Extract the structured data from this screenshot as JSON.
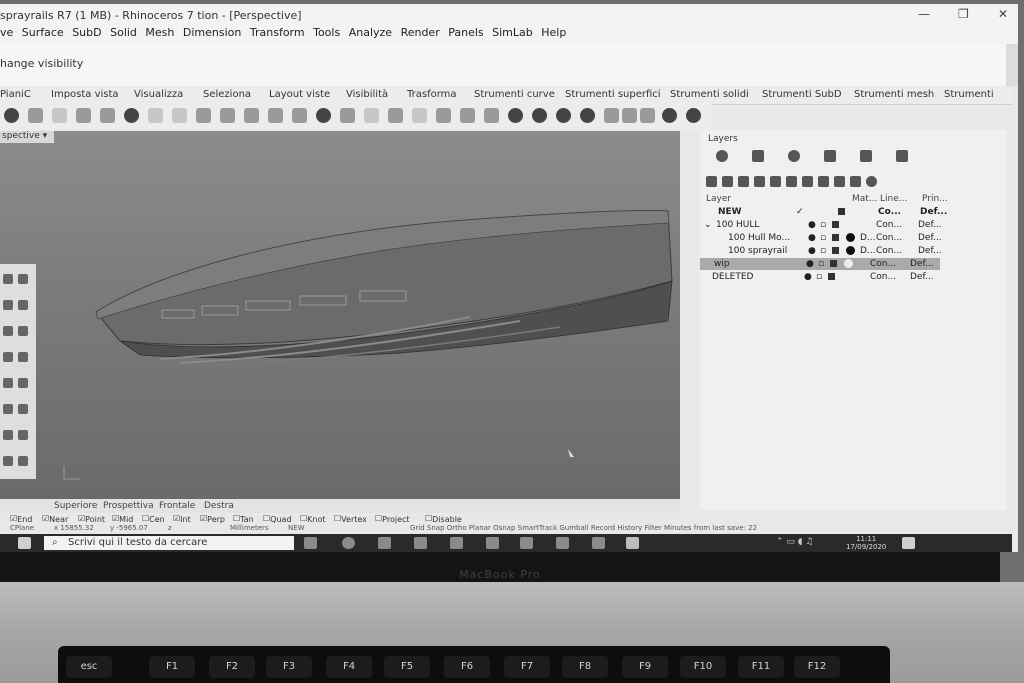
{
  "window": {
    "title": "sprayrails R7 (1 MB) - Rhinoceros 7 tion - [Perspective]",
    "controls": [
      "—",
      "❐",
      "✕"
    ]
  },
  "menu": [
    "ve",
    "Surface",
    "SubD",
    "Solid",
    "Mesh",
    "Dimension",
    "Transform",
    "Tools",
    "Analyze",
    "Render",
    "Panels",
    "SimLab",
    "Help"
  ],
  "command_history": "hange visibility",
  "tabs": [
    "PianiC",
    "Imposta vista",
    "Visualizza",
    "Seleziona",
    "Layout viste",
    "Visibilità",
    "Trasforma",
    "Strumenti curve",
    "Strumenti superfici",
    "Strumenti solidi",
    "Strumenti SubD",
    "Strumenti mesh",
    "Strumenti"
  ],
  "viewport": {
    "label": "spective ▾"
  },
  "layers_panel": {
    "title": "Layers",
    "columns": {
      "layer": "Layer",
      "material": "Mat...",
      "linetype": "Line...",
      "print": "Prin..."
    },
    "rows": [
      {
        "name": "NEW",
        "check": "✓",
        "linetype": "Co...",
        "print": "Def...",
        "bold": true
      },
      {
        "name": "100 HULL",
        "expand": "⌄",
        "linetype": "Con...",
        "print": "Def..."
      },
      {
        "name": "100 Hull Mo...",
        "d": "D...",
        "linetype": "Con...",
        "print": "Def..."
      },
      {
        "name": "100 sprayrail",
        "d": "D...",
        "linetype": "Con...",
        "print": "Def..."
      },
      {
        "name": "wip",
        "linetype": "Con...",
        "print": "Def..."
      },
      {
        "name": "DELETED",
        "linetype": "Con...",
        "print": "Def..."
      }
    ]
  },
  "viewport_tabs": [
    "Superiore",
    "Prospettiva",
    "Frontale",
    "Destra"
  ],
  "osnaps": [
    {
      "label": "End",
      "checked": true
    },
    {
      "label": "Near",
      "checked": true
    },
    {
      "label": "Point",
      "checked": true
    },
    {
      "label": "Mid",
      "checked": true
    },
    {
      "label": "Cen",
      "checked": false
    },
    {
      "label": "Int",
      "checked": true
    },
    {
      "label": "Perp",
      "checked": true
    },
    {
      "label": "Tan",
      "checked": false
    },
    {
      "label": "Quad",
      "checked": false
    },
    {
      "label": "Knot",
      "checked": false
    },
    {
      "label": "Vertex",
      "checked": false
    },
    {
      "label": "Project",
      "checked": false
    },
    {
      "label": "Disable",
      "checked": false
    }
  ],
  "status": {
    "cplane": "CPlane",
    "x": "x 15855.32",
    "y": "y -5965.07",
    "z": "z",
    "units": "Millimeters",
    "layer": "NEW",
    "toggles": "Grid Snap  Ortho  Planar  Osnap  SmartTrack  Gumball  Record History  Filter  Minutes from last save: 22"
  },
  "taskbar": {
    "search_placeholder": "Scrivi qui il testo da cercare",
    "time": "11:11",
    "date": "17/09/2020"
  },
  "laptop": {
    "brand": "MacBook Pro",
    "keys": [
      "esc",
      "F1",
      "F2",
      "F3",
      "F4",
      "F5",
      "F6",
      "F7",
      "F8",
      "F9",
      "F10",
      "F11",
      "F12"
    ]
  }
}
